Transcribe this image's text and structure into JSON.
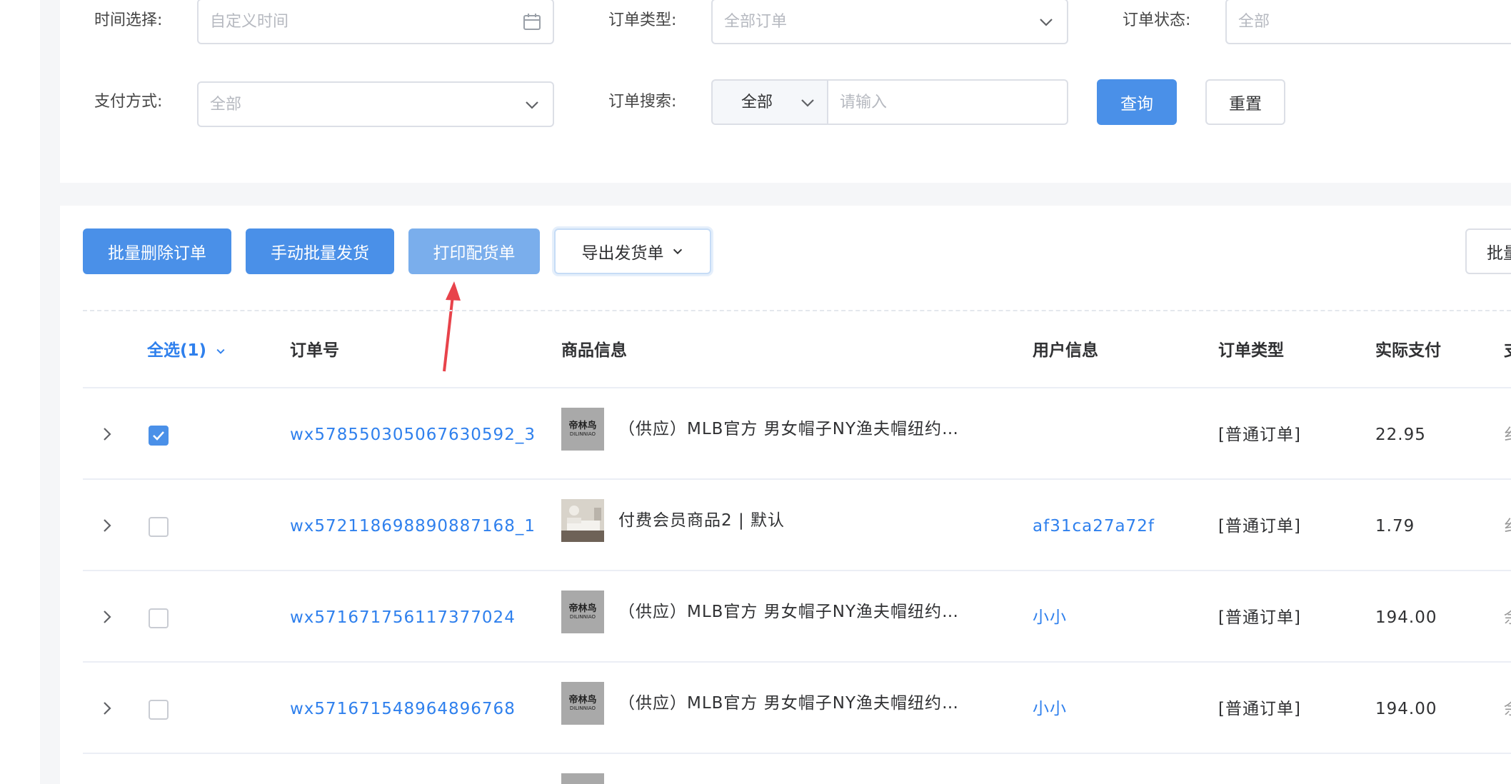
{
  "filters": {
    "time_label": "时间选择:",
    "time_placeholder": "自定义时间",
    "order_type_label": "订单类型:",
    "order_type_value": "全部订单",
    "order_status_label": "订单状态:",
    "order_status_value": "全部",
    "pay_method_label": "支付方式:",
    "pay_method_value": "全部",
    "search_label": "订单搜索:",
    "search_scope_value": "全部",
    "search_placeholder": "请输入",
    "query_button": "查询",
    "reset_button": "重置"
  },
  "toolbar": {
    "batch_delete": "批量删除订单",
    "batch_ship": "手动批量发货",
    "print_picking": "打印配货单",
    "export_shipping": "导出发货单",
    "right_button_partial": "批量"
  },
  "table": {
    "headers": {
      "select_all": "全选(1)",
      "order_no": "订单号",
      "product": "商品信息",
      "user": "用户信息",
      "order_type": "订单类型",
      "paid": "实际支付",
      "partial": "支"
    },
    "rows": [
      {
        "checked": true,
        "order_no": "wx578550305067630592_3",
        "thumb_brand": "帝林鸟",
        "thumb_sub": "DILINNIAO",
        "product": "（供应）MLB官方 男女帽子NY渔夫帽纽约…",
        "user": "",
        "order_type": "[普通订单]",
        "paid": "22.95",
        "edge": "纟"
      },
      {
        "checked": false,
        "order_no": "wx572118698890887168_1",
        "thumb_brand": "",
        "thumb_sub": "",
        "product": "付费会员商品2 | 默认",
        "user": "af31ca27a72f",
        "order_type": "[普通订单]",
        "paid": "1.79",
        "edge": "纟"
      },
      {
        "checked": false,
        "order_no": "wx571671756117377024",
        "thumb_brand": "帝林鸟",
        "thumb_sub": "DILINNIAO",
        "product": "（供应）MLB官方 男女帽子NY渔夫帽纽约…",
        "user": "小小",
        "order_type": "[普通订单]",
        "paid": "194.00",
        "edge": "余"
      },
      {
        "checked": false,
        "order_no": "wx571671548964896768",
        "thumb_brand": "帝林鸟",
        "thumb_sub": "DILINNIAO",
        "product": "（供应）MLB官方 男女帽子NY渔夫帽纽约…",
        "user": "小小",
        "order_type": "[普通订单]",
        "paid": "194.00",
        "edge": "余"
      }
    ]
  },
  "colors": {
    "primary": "#4a90e8",
    "annotation_arrow": "#e8434b",
    "link": "#2f80ed"
  },
  "icons": [
    "calendar-icon",
    "chevron-down-icon",
    "chevron-right-icon",
    "check-icon",
    "annotation-arrow"
  ]
}
